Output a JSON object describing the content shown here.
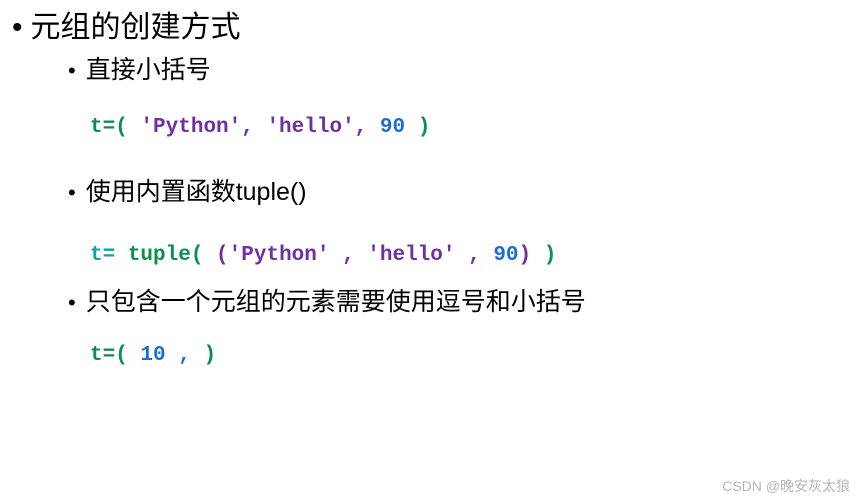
{
  "bullets": {
    "l1_1": "元组的创建方式",
    "l2_1": "直接小括号",
    "l2_2": "使用内置函数tuple()",
    "l2_3": "只包含一个元组的元素需要使用逗号和小括号"
  },
  "code1": {
    "lhs": "t=",
    "paren_open": "(",
    "items_part1": " 'Python',  'hello',  ",
    "items_num": "90   ",
    "paren_close": ")"
  },
  "code2": {
    "lhs": "t= ",
    "fn": "tuple",
    "outer_open": "(",
    "inner_open": "  (",
    "inner_items_str": "'Python' , 'hello'  , ",
    "inner_items_num": "90",
    "inner_close": ")  ",
    "outer_close": ")"
  },
  "code3": {
    "lhs": "t=",
    "paren_open": "(",
    "num": "  10 ,  ",
    "paren_close": ")"
  },
  "watermark": "CSDN @晚安灰太狼"
}
